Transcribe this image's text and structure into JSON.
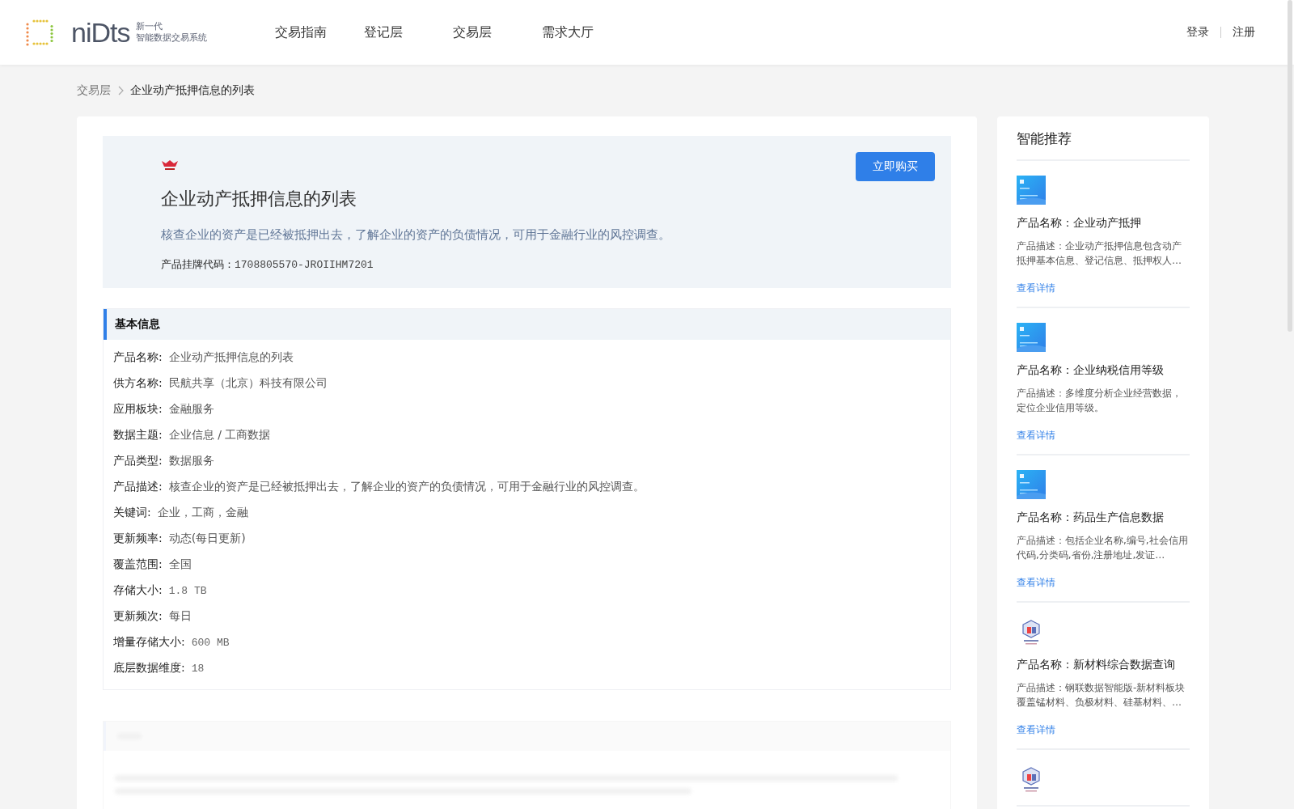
{
  "header": {
    "logo_word": "niDts",
    "logo_line1": "新一代",
    "logo_line2": "智能数据交易系统",
    "nav": [
      {
        "label": "交易指南",
        "selected": false
      },
      {
        "label": "登记层",
        "selected": false
      },
      {
        "label": "交易层",
        "selected": false
      },
      {
        "label": "需求大厅",
        "selected": false
      }
    ],
    "auth": [
      "登录",
      "注册"
    ]
  },
  "breadcrumb": [
    "交易层",
    "企业动产抵押信息的列表"
  ],
  "product": {
    "title": "企业动产抵押信息的列表",
    "summary": "核查企业的资产是已经被抵押出去，了解企业的资产的负债情况，可用于金融行业的风控调查。",
    "code_label": "产品挂牌代码：",
    "code": "1708805570-JROIIHM7201",
    "buy_button": "立即购买"
  },
  "basic_info": {
    "title": "基本信息",
    "fields": [
      {
        "label": "产品名称:",
        "value": "企业动产抵押信息的列表",
        "kind": "text"
      },
      {
        "label": "供方名称:",
        "value": "民航共享（北京）科技有限公司",
        "kind": "text"
      },
      {
        "label": "应用板块:",
        "value": "金融服务",
        "kind": "text"
      },
      {
        "label": "数据主题:",
        "value": "企业信息 / 工商数据",
        "kind": "text"
      },
      {
        "label": "产品类型:",
        "value": "数据服务",
        "kind": "text"
      },
      {
        "label": "产品描述:",
        "value": "核查企业的资产是已经被抵押出去，了解企业的资产的负债情况，可用于金融行业的风控调查。",
        "kind": "text"
      },
      {
        "label": "关键词:",
        "value": "企业，工商，金融",
        "kind": "text"
      },
      {
        "label": "更新频率:",
        "value": "动态(每日更新)",
        "kind": "text"
      },
      {
        "label": "覆盖范围:",
        "value": "全国",
        "kind": "text"
      },
      {
        "label": "存储大小:",
        "value": "1.8 TB",
        "kind": "number"
      },
      {
        "label": "更新频次:",
        "value": "每日",
        "kind": "text"
      },
      {
        "label": "增量存储大小:",
        "value": "600 MB",
        "kind": "number"
      },
      {
        "label": "底层数据维度:",
        "value": "18",
        "kind": "number"
      }
    ]
  },
  "recommend": {
    "title": "智能推荐",
    "items": [
      {
        "kind": "picture",
        "name": "产品名称：企业动产抵押",
        "desc": "产品描述：企业动产抵押信息包含动产抵押基本信息、登记信息、抵押权人…",
        "link": "查看详情"
      },
      {
        "kind": "picture",
        "name": "产品名称：企业纳税信用等级",
        "desc": "产品描述：多维度分析企业经营数据，定位企业信用等级。",
        "link": "查看详情"
      },
      {
        "kind": "picture",
        "name": "产品名称：药品生产信息数据",
        "desc": "产品描述：包括企业名称,编号,社会信用代码,分类码,省份,注册地址,发证…",
        "link": "查看详情"
      },
      {
        "kind": "logo",
        "name": "产品名称：新材料综合数据查询",
        "desc": "产品描述：钢联数据智能版-新材料板块覆盖锰材料、负极材料、硅基材料、…",
        "link": "查看详情"
      },
      {
        "kind": "logo"
      }
    ]
  }
}
